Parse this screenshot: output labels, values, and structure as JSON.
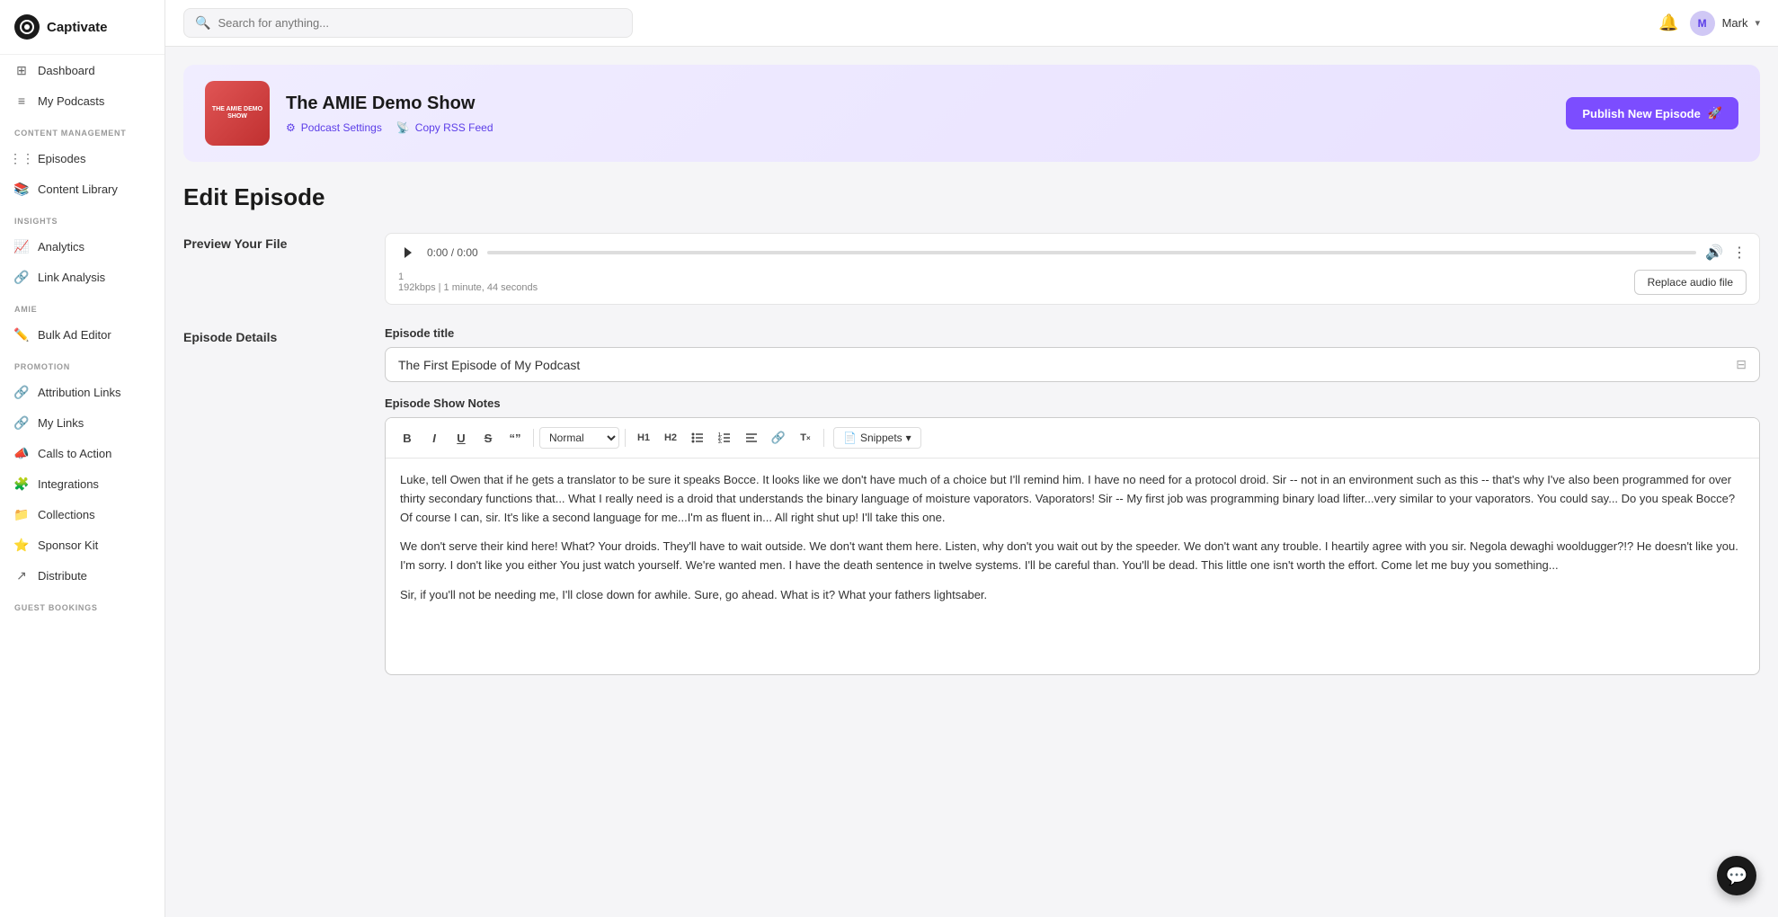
{
  "app": {
    "name": "Captivate",
    "logo_text": "Captivate"
  },
  "topnav": {
    "search_placeholder": "Search for anything...",
    "user_name": "Mark",
    "user_initial": "M"
  },
  "sidebar": {
    "top_items": [
      {
        "id": "dashboard",
        "label": "Dashboard",
        "icon": "grid"
      },
      {
        "id": "my-podcasts",
        "label": "My Podcasts",
        "icon": "list"
      }
    ],
    "sections": [
      {
        "label": "Content Management",
        "items": [
          {
            "id": "episodes",
            "label": "Episodes",
            "icon": "list-lines"
          },
          {
            "id": "content-library",
            "label": "Content Library",
            "icon": "book"
          }
        ]
      },
      {
        "label": "Insights",
        "items": [
          {
            "id": "analytics",
            "label": "Analytics",
            "icon": "chart"
          },
          {
            "id": "link-analysis",
            "label": "Link Analysis",
            "icon": "link"
          }
        ]
      },
      {
        "label": "AMIE",
        "items": [
          {
            "id": "bulk-ad-editor",
            "label": "Bulk Ad Editor",
            "icon": "edit"
          }
        ]
      },
      {
        "label": "Promotion",
        "items": [
          {
            "id": "attribution-links",
            "label": "Attribution Links",
            "icon": "link2"
          },
          {
            "id": "my-links",
            "label": "My Links",
            "icon": "link3"
          },
          {
            "id": "calls-to-action",
            "label": "Calls to Action",
            "icon": "megaphone"
          },
          {
            "id": "integrations",
            "label": "Integrations",
            "icon": "puzzle"
          },
          {
            "id": "collections",
            "label": "Collections",
            "icon": "folder"
          },
          {
            "id": "sponsor-kit",
            "label": "Sponsor Kit",
            "icon": "star"
          },
          {
            "id": "distribute",
            "label": "Distribute",
            "icon": "share"
          }
        ]
      },
      {
        "label": "Guest Bookings",
        "items": []
      }
    ]
  },
  "podcast_banner": {
    "title": "The AMIE Demo Show",
    "thumb_text": "THE AMIE DEMO SHOW",
    "settings_label": "Podcast Settings",
    "rss_label": "Copy RSS Feed",
    "publish_btn": "Publish New Episode"
  },
  "edit_episode": {
    "page_title": "Edit Episode",
    "preview_label": "Preview Your File",
    "audio_time": "0:00 / 0:00",
    "audio_meta": "192kbps | 1 minute, 44 seconds",
    "audio_meta_line1": "1",
    "replace_btn": "Replace audio file",
    "episode_details_label": "Episode Details",
    "episode_title_label": "Episode title",
    "episode_title_value": "The First Episode of My Podcast",
    "show_notes_label": "Episode Show Notes",
    "toolbar": {
      "bold": "B",
      "italic": "I",
      "underline": "U",
      "strikethrough": "S",
      "quote": "“”",
      "normal_select": "Normal",
      "h1": "H1",
      "h2": "H2",
      "ul": "ul",
      "ol": "ol",
      "align": "align",
      "link": "link",
      "clear": "Tx",
      "snippets": "Snippets"
    },
    "show_notes_content": [
      "Luke, tell Owen that if he gets a translator to be sure it speaks Bocce. It looks like we don't have much of a choice but I'll remind him. I have no need for a protocol droid. Sir -- not in an environment such as this -- that's why I've also been programmed for over thirty secondary functions that... What I really need is a droid that understands the binary language of moisture vaporators. Vaporators! Sir -- My first job was programming binary load lifter...very similar to your vaporators. You could say... Do you speak Bocce? Of course I can, sir. It's like a second language for me...I'm as fluent in... All right shut up! I'll take this one.",
      "We don't serve their kind here! What? Your droids. They'll have to wait outside. We don't want them here. Listen, why don't you wait out by the speeder. We don't want any trouble. I heartily agree with you sir. Negola dewaghi wooldugger?!? He doesn't like you. I'm sorry. I don't like you either You just watch yourself. We're wanted men. I have the death sentence in twelve systems. I'll be careful than. You'll be dead. This little one isn't worth the effort. Come let me buy you something...",
      "Sir, if you'll not be needing me, I'll close down for awhile. Sure, go ahead. What is it? What your fathers lightsaber."
    ]
  }
}
